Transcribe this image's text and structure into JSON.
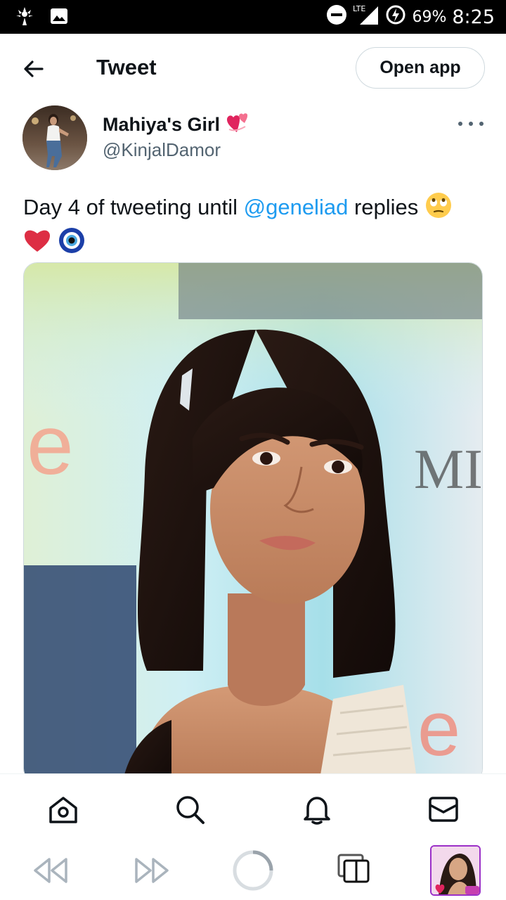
{
  "status_bar": {
    "network": "LTE",
    "battery": "69%",
    "time": "8:25"
  },
  "header": {
    "title": "Tweet",
    "open_app_label": "Open app"
  },
  "tweet": {
    "author": {
      "display_name": "Mahiya's Girl",
      "handle": "@KinjalDamor"
    },
    "text_before": "Day 4 of tweeting until ",
    "mention": "@geneliad",
    "text_after": " replies"
  },
  "bottom_nav": [
    "home",
    "search",
    "notifications",
    "messages"
  ],
  "colors": {
    "accent": "#1d9bf0",
    "text": "#0f1419",
    "secondary_text": "#536471",
    "border": "#cfd9de"
  }
}
